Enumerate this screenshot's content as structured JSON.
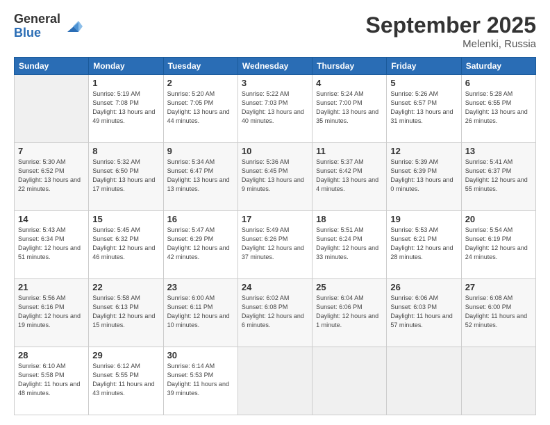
{
  "logo": {
    "general": "General",
    "blue": "Blue"
  },
  "title": "September 2025",
  "location": "Melenki, Russia",
  "days_header": [
    "Sunday",
    "Monday",
    "Tuesday",
    "Wednesday",
    "Thursday",
    "Friday",
    "Saturday"
  ],
  "weeks": [
    [
      {
        "num": "",
        "empty": true
      },
      {
        "num": "1",
        "sunrise": "Sunrise: 5:19 AM",
        "sunset": "Sunset: 7:08 PM",
        "daylight": "Daylight: 13 hours and 49 minutes."
      },
      {
        "num": "2",
        "sunrise": "Sunrise: 5:20 AM",
        "sunset": "Sunset: 7:05 PM",
        "daylight": "Daylight: 13 hours and 44 minutes."
      },
      {
        "num": "3",
        "sunrise": "Sunrise: 5:22 AM",
        "sunset": "Sunset: 7:03 PM",
        "daylight": "Daylight: 13 hours and 40 minutes."
      },
      {
        "num": "4",
        "sunrise": "Sunrise: 5:24 AM",
        "sunset": "Sunset: 7:00 PM",
        "daylight": "Daylight: 13 hours and 35 minutes."
      },
      {
        "num": "5",
        "sunrise": "Sunrise: 5:26 AM",
        "sunset": "Sunset: 6:57 PM",
        "daylight": "Daylight: 13 hours and 31 minutes."
      },
      {
        "num": "6",
        "sunrise": "Sunrise: 5:28 AM",
        "sunset": "Sunset: 6:55 PM",
        "daylight": "Daylight: 13 hours and 26 minutes."
      }
    ],
    [
      {
        "num": "7",
        "sunrise": "Sunrise: 5:30 AM",
        "sunset": "Sunset: 6:52 PM",
        "daylight": "Daylight: 13 hours and 22 minutes."
      },
      {
        "num": "8",
        "sunrise": "Sunrise: 5:32 AM",
        "sunset": "Sunset: 6:50 PM",
        "daylight": "Daylight: 13 hours and 17 minutes."
      },
      {
        "num": "9",
        "sunrise": "Sunrise: 5:34 AM",
        "sunset": "Sunset: 6:47 PM",
        "daylight": "Daylight: 13 hours and 13 minutes."
      },
      {
        "num": "10",
        "sunrise": "Sunrise: 5:36 AM",
        "sunset": "Sunset: 6:45 PM",
        "daylight": "Daylight: 13 hours and 9 minutes."
      },
      {
        "num": "11",
        "sunrise": "Sunrise: 5:37 AM",
        "sunset": "Sunset: 6:42 PM",
        "daylight": "Daylight: 13 hours and 4 minutes."
      },
      {
        "num": "12",
        "sunrise": "Sunrise: 5:39 AM",
        "sunset": "Sunset: 6:39 PM",
        "daylight": "Daylight: 13 hours and 0 minutes."
      },
      {
        "num": "13",
        "sunrise": "Sunrise: 5:41 AM",
        "sunset": "Sunset: 6:37 PM",
        "daylight": "Daylight: 12 hours and 55 minutes."
      }
    ],
    [
      {
        "num": "14",
        "sunrise": "Sunrise: 5:43 AM",
        "sunset": "Sunset: 6:34 PM",
        "daylight": "Daylight: 12 hours and 51 minutes."
      },
      {
        "num": "15",
        "sunrise": "Sunrise: 5:45 AM",
        "sunset": "Sunset: 6:32 PM",
        "daylight": "Daylight: 12 hours and 46 minutes."
      },
      {
        "num": "16",
        "sunrise": "Sunrise: 5:47 AM",
        "sunset": "Sunset: 6:29 PM",
        "daylight": "Daylight: 12 hours and 42 minutes."
      },
      {
        "num": "17",
        "sunrise": "Sunrise: 5:49 AM",
        "sunset": "Sunset: 6:26 PM",
        "daylight": "Daylight: 12 hours and 37 minutes."
      },
      {
        "num": "18",
        "sunrise": "Sunrise: 5:51 AM",
        "sunset": "Sunset: 6:24 PM",
        "daylight": "Daylight: 12 hours and 33 minutes."
      },
      {
        "num": "19",
        "sunrise": "Sunrise: 5:53 AM",
        "sunset": "Sunset: 6:21 PM",
        "daylight": "Daylight: 12 hours and 28 minutes."
      },
      {
        "num": "20",
        "sunrise": "Sunrise: 5:54 AM",
        "sunset": "Sunset: 6:19 PM",
        "daylight": "Daylight: 12 hours and 24 minutes."
      }
    ],
    [
      {
        "num": "21",
        "sunrise": "Sunrise: 5:56 AM",
        "sunset": "Sunset: 6:16 PM",
        "daylight": "Daylight: 12 hours and 19 minutes."
      },
      {
        "num": "22",
        "sunrise": "Sunrise: 5:58 AM",
        "sunset": "Sunset: 6:13 PM",
        "daylight": "Daylight: 12 hours and 15 minutes."
      },
      {
        "num": "23",
        "sunrise": "Sunrise: 6:00 AM",
        "sunset": "Sunset: 6:11 PM",
        "daylight": "Daylight: 12 hours and 10 minutes."
      },
      {
        "num": "24",
        "sunrise": "Sunrise: 6:02 AM",
        "sunset": "Sunset: 6:08 PM",
        "daylight": "Daylight: 12 hours and 6 minutes."
      },
      {
        "num": "25",
        "sunrise": "Sunrise: 6:04 AM",
        "sunset": "Sunset: 6:06 PM",
        "daylight": "Daylight: 12 hours and 1 minute."
      },
      {
        "num": "26",
        "sunrise": "Sunrise: 6:06 AM",
        "sunset": "Sunset: 6:03 PM",
        "daylight": "Daylight: 11 hours and 57 minutes."
      },
      {
        "num": "27",
        "sunrise": "Sunrise: 6:08 AM",
        "sunset": "Sunset: 6:00 PM",
        "daylight": "Daylight: 11 hours and 52 minutes."
      }
    ],
    [
      {
        "num": "28",
        "sunrise": "Sunrise: 6:10 AM",
        "sunset": "Sunset: 5:58 PM",
        "daylight": "Daylight: 11 hours and 48 minutes."
      },
      {
        "num": "29",
        "sunrise": "Sunrise: 6:12 AM",
        "sunset": "Sunset: 5:55 PM",
        "daylight": "Daylight: 11 hours and 43 minutes."
      },
      {
        "num": "30",
        "sunrise": "Sunrise: 6:14 AM",
        "sunset": "Sunset: 5:53 PM",
        "daylight": "Daylight: 11 hours and 39 minutes."
      },
      {
        "num": "",
        "empty": true
      },
      {
        "num": "",
        "empty": true
      },
      {
        "num": "",
        "empty": true
      },
      {
        "num": "",
        "empty": true
      }
    ]
  ]
}
